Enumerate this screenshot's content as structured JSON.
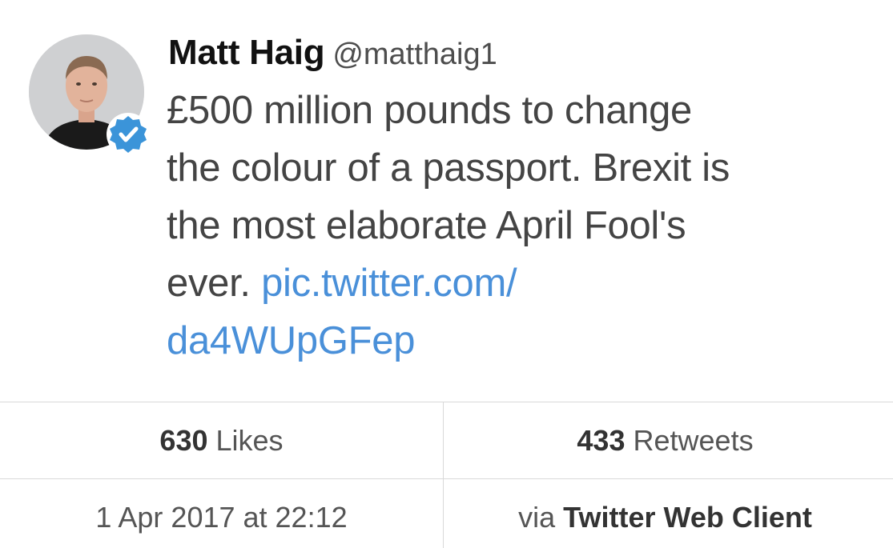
{
  "tweet": {
    "author_name": "Matt Haig",
    "author_handle": "@matthaig1",
    "verified": true,
    "text_plain": "£500 million pounds to change the colour of a passport. Brexit is the most elaborate April Fool's ever.",
    "link_text": "pic.twitter.com/ da4WUpGFep",
    "link_line1": "pic.twitter.com/",
    "link_line2": "da4WUpGFep",
    "line1": "£500 million pounds to change",
    "line2": "the colour of a passport. Brexit is",
    "line3": "the most elaborate April Fool's",
    "line4_prefix": "ever."
  },
  "stats": {
    "likes_count": "630",
    "likes_label": "Likes",
    "retweets_count": "433",
    "retweets_label": "Retweets"
  },
  "meta": {
    "timestamp": "1 Apr 2017 at 22:12",
    "via_label": "via",
    "client": "Twitter Web Client"
  },
  "icons": {
    "avatar": "profile-photo",
    "verified": "verified-badge-icon"
  },
  "colors": {
    "link": "#4a90d9",
    "verified_badge": "#3b94d9",
    "divider": "#d9d9d9"
  }
}
